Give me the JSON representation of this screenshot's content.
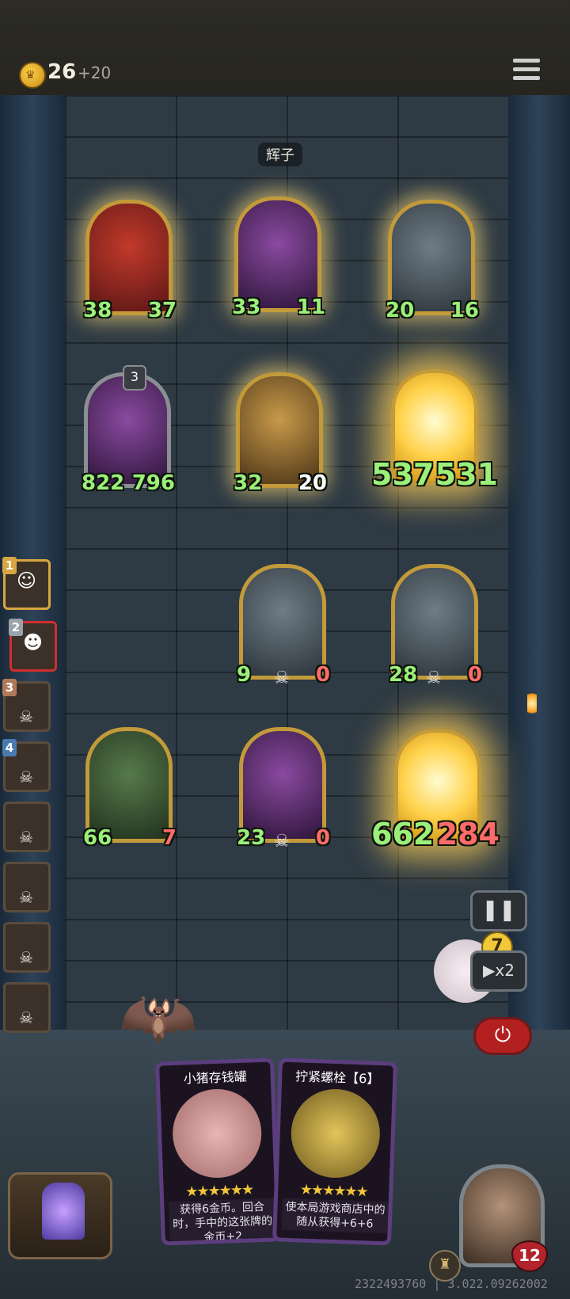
{
  "top": {
    "gold": "26",
    "gold_income": "+20"
  },
  "opponent_name": "辉子",
  "board": {
    "row1": [
      {
        "atk": "38",
        "hp": "37"
      },
      {
        "atk": "33",
        "hp": "11"
      },
      {
        "atk": "20",
        "hp": "16"
      }
    ],
    "row2": [
      {
        "atk": "822",
        "hp": "796",
        "level": "3"
      },
      {
        "atk": "32",
        "hp": "20"
      },
      {
        "atk": "537",
        "hp": "531"
      }
    ],
    "row3": [
      {
        "atk": "9",
        "hp": "0"
      },
      {
        "atk": "28",
        "hp": "0"
      }
    ],
    "row4": [
      {
        "atk": "66",
        "hp": "7"
      },
      {
        "atk": "23",
        "hp": "0"
      },
      {
        "atk": "662",
        "hp": "284"
      }
    ]
  },
  "queue": [
    {
      "num": "1"
    },
    {
      "num": "2"
    },
    {
      "num": "3"
    },
    {
      "num": "4"
    }
  ],
  "controls": {
    "pause_icon": "❚❚",
    "speed_label": "▶x2",
    "power_icon": "⏻",
    "count_badge": "7"
  },
  "hand": [
    {
      "title": "小猪存钱罐",
      "desc": "获得6金币。回合时，手中的这张牌的金币+2",
      "icon": "piggy-bank-icon"
    },
    {
      "title": "拧紧螺栓【6】",
      "desc": "使本局游戏商店中的随从获得+6+6",
      "icon": "bolt-icon"
    }
  ],
  "hero": {
    "hp": "12"
  },
  "build_id": "2322493760 | 3.022.09262002"
}
